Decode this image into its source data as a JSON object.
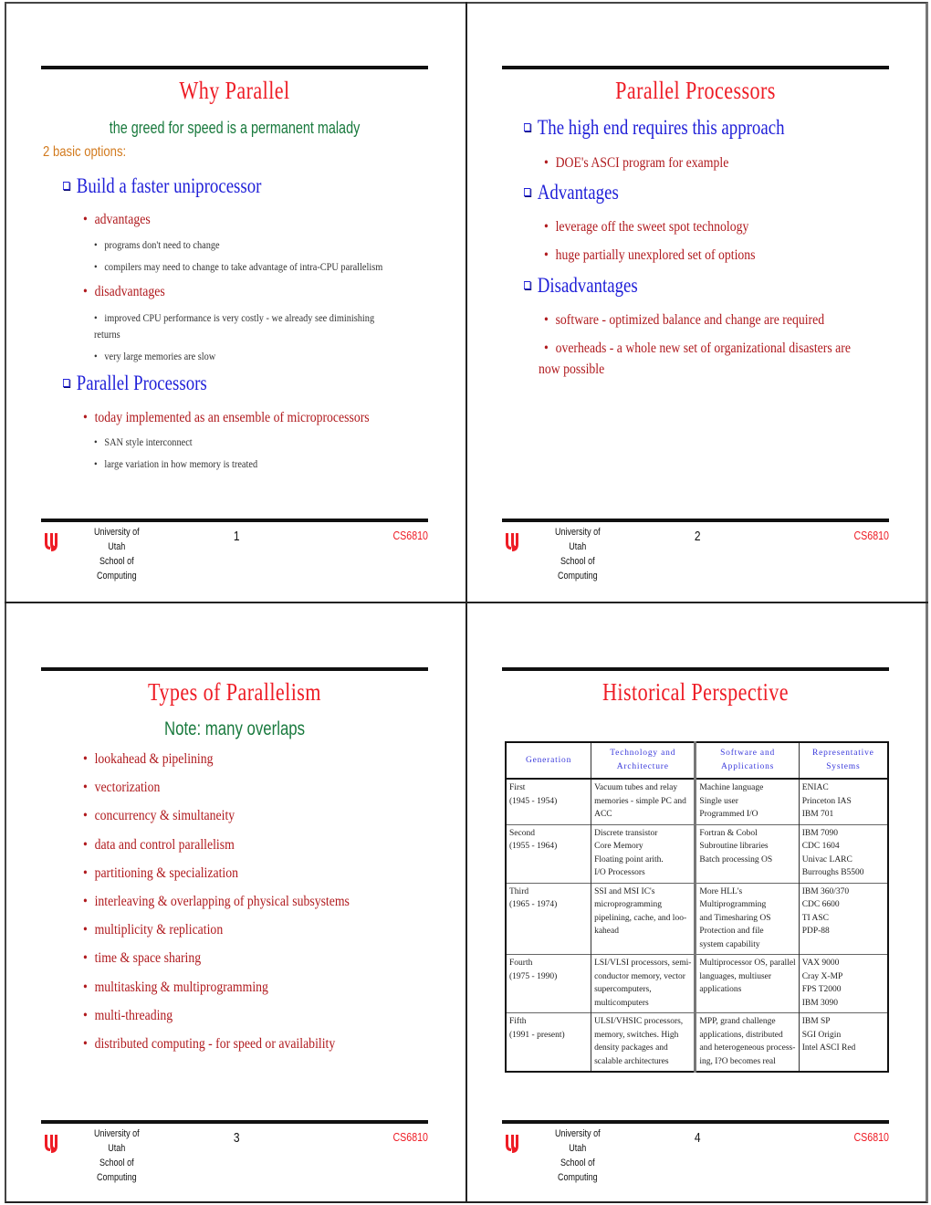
{
  "slides": [
    {
      "title": "Why Parallel",
      "subtitle": "the greed for speed is a permanent malady",
      "intro": "2 basic options:",
      "items": [
        {
          "level": 1,
          "text": "Build a faster uniprocessor"
        },
        {
          "level": 2,
          "text": "advantages"
        },
        {
          "level": 3,
          "text": "programs don't need to change"
        },
        {
          "level": 3,
          "text": "compilers may need to change to take advantage of intra-CPU parallelism"
        },
        {
          "level": 2,
          "text": "disadvantages"
        },
        {
          "level": 3,
          "text": "improved CPU performance is very costly - we already see diminishing returns"
        },
        {
          "level": 3,
          "text": "very large memories are slow"
        },
        {
          "level": 1,
          "text": "Parallel Processors"
        },
        {
          "level": 2,
          "text": "today implemented as an ensemble of microprocessors"
        },
        {
          "level": 3,
          "text": "SAN style interconnect"
        },
        {
          "level": 3,
          "text": "large variation in how memory is treated"
        }
      ],
      "footer": {
        "univ_line1": "University of Utah",
        "univ_line2": "School of Computing",
        "page": "1",
        "course": "CS6810"
      }
    },
    {
      "title": "Parallel Processors",
      "items": [
        {
          "level": 1,
          "text": "The high end requires this approach"
        },
        {
          "level": 2,
          "text": "DOE's ASCI program for example"
        },
        {
          "level": 1,
          "text": "Advantages"
        },
        {
          "level": 2,
          "text": "leverage off the sweet spot technology"
        },
        {
          "level": 2,
          "text": "huge partially unexplored set of options"
        },
        {
          "level": 1,
          "text": "Disadvantages"
        },
        {
          "level": 2,
          "text": "software - optimized balance and change are required"
        },
        {
          "level": 2,
          "text": "overheads - a whole new set of organizational disasters are",
          "continuation": "now possible"
        }
      ],
      "footer": {
        "univ_line1": "University of Utah",
        "univ_line2": "School of Computing",
        "page": "2",
        "course": "CS6810"
      }
    },
    {
      "title": "Types of Parallelism",
      "subtitle": "Note: many overlaps",
      "items": [
        {
          "level": 2,
          "text": "lookahead & pipelining"
        },
        {
          "level": 2,
          "text": "vectorization"
        },
        {
          "level": 2,
          "text": "concurrency & simultaneity"
        },
        {
          "level": 2,
          "text": "data and control parallelism"
        },
        {
          "level": 2,
          "text": "partitioning & specialization"
        },
        {
          "level": 2,
          "text": "interleaving & overlapping of physical subsystems"
        },
        {
          "level": 2,
          "text": "multiplicity & replication"
        },
        {
          "level": 2,
          "text": "time & space sharing"
        },
        {
          "level": 2,
          "text": "multitasking & multiprogramming"
        },
        {
          "level": 2,
          "text": "multi-threading"
        },
        {
          "level": 2,
          "text": "distributed computing - for speed or availability"
        }
      ],
      "footer": {
        "univ_line1": "University of Utah",
        "univ_line2": "School of Computing",
        "page": "3",
        "course": "CS6810"
      }
    },
    {
      "title": "Historical Perspective",
      "table": {
        "headers": [
          [
            "Generation"
          ],
          [
            "Technology and",
            "Architecture"
          ],
          [
            "Software and",
            "Applications"
          ],
          [
            "Representative",
            "Systems"
          ]
        ],
        "rows": [
          [
            [
              "First",
              "(1945 - 1954)"
            ],
            [
              "Vacuum tubes and relay",
              "memories - simple PC and",
              "ACC"
            ],
            [
              "Machine language",
              "Single user",
              "Programmed I/O"
            ],
            [
              "ENIAC",
              "Princeton IAS",
              "IBM 701"
            ]
          ],
          [
            [
              "Second",
              "(1955 - 1964)"
            ],
            [
              "Discrete transistor",
              "Core Memory",
              "Floating point arith.",
              "I/O Processors"
            ],
            [
              "Fortran & Cobol",
              "Subroutine libraries",
              "Batch processing OS"
            ],
            [
              "IBM 7090",
              "CDC 1604",
              "Univac LARC",
              "Burroughs B5500"
            ]
          ],
          [
            [
              "Third",
              "(1965 - 1974)"
            ],
            [
              "SSI and MSI IC's",
              "microprogramming",
              "pipelining, cache, and loo-",
              "kahead"
            ],
            [
              "More HLL's",
              "Multiprogramming",
              "and Timesharing OS",
              "Protection and file",
              "system capability"
            ],
            [
              "IBM 360/370",
              "CDC 6600",
              "TI ASC",
              "PDP-88"
            ]
          ],
          [
            [
              "Fourth",
              "(1975 - 1990)"
            ],
            [
              "LSI/VLSI processors, semi-",
              "conductor memory, vector",
              "supercomputers,",
              "multicomputers"
            ],
            [
              "Multiprocessor OS, parallel",
              "languages, multiuser",
              "applications"
            ],
            [
              "VAX 9000",
              "Cray X-MP",
              "FPS T2000",
              "IBM 3090"
            ]
          ],
          [
            [
              "Fifth",
              "(1991 - present)"
            ],
            [
              "ULSI/VHSIC processors,",
              "memory, switches. High",
              "density packages and",
              "scalable architectures"
            ],
            [
              "MPP, grand challenge",
              "applications, distributed",
              "and heterogeneous process-",
              "ing, I?O becomes real"
            ],
            [
              "IBM SP",
              "SGI Origin",
              "Intel ASCI Red"
            ]
          ]
        ]
      },
      "footer": {
        "univ_line1": "University of Utah",
        "univ_line2": "School of Computing",
        "page": "4",
        "course": "CS6810"
      }
    }
  ],
  "glyphs": {
    "bullet": "•",
    "checkbox_marker": "square-box-icon"
  },
  "colors": {
    "title": "#ee1c25",
    "level1": "#1f1fd8",
    "level2": "#b01a1e",
    "level3": "#333333",
    "subtitle": "#1a7a3e",
    "intro": "#d27a1e",
    "table_header": "#3a3adb"
  }
}
